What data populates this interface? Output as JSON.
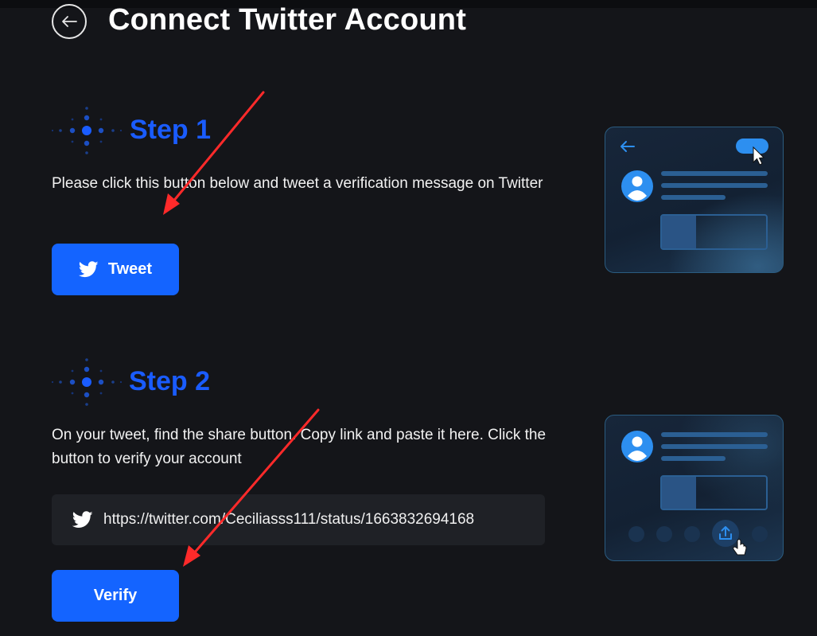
{
  "header": {
    "title": "Connect Twitter Account"
  },
  "step1": {
    "title": "Step 1",
    "description": "Please click this button below and tweet a verification message on Twitter",
    "button_label": "Tweet"
  },
  "step2": {
    "title": "Step 2",
    "description": "On your tweet, find the share button. Copy link and paste it here. Click the button to verify your account",
    "link_value": "https://twitter.com/Ceciliasss111/status/1663832694168",
    "button_label": "Verify"
  },
  "colors": {
    "background": "#141519",
    "accent": "#1464ff",
    "step_title": "#1a5cff",
    "annotation_arrow": "#ff2a2a"
  },
  "icons": [
    "back-arrow-icon",
    "twitter-bird-icon",
    "dots-decoration-icon",
    "cursor-icon",
    "share-icon"
  ]
}
